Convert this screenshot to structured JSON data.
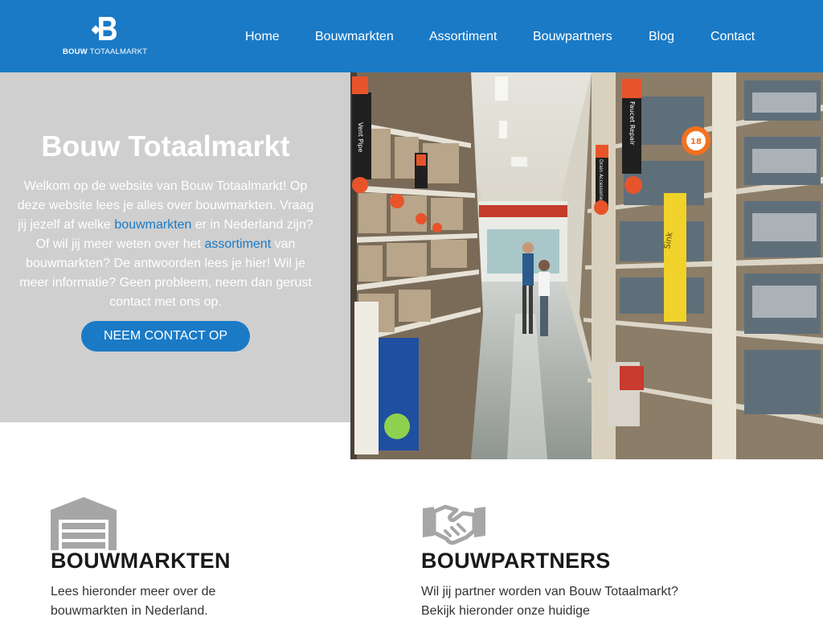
{
  "header": {
    "logo_text_bold": "BOUW",
    "logo_text_rest": "TOTAALMARKT",
    "nav": [
      {
        "label": "Home"
      },
      {
        "label": "Bouwmarkten"
      },
      {
        "label": "Assortiment"
      },
      {
        "label": "Bouwpartners"
      },
      {
        "label": "Blog"
      },
      {
        "label": "Contact"
      }
    ]
  },
  "hero": {
    "title": "Bouw Totaalmarkt",
    "text_1": "Welkom op de website van Bouw Totaalmarkt! Op deze website lees je alles over bouwmarkten. Vraag jij jezelf af welke ",
    "link_1": "bouwmarkten",
    "text_2": " er in Nederland zijn? Of wil jij meer weten over het ",
    "link_2": "assortiment",
    "text_3": " van bouwmarkten? De antwoorden lees je hier! Wil je meer informatie? Geen probleem, neem dan gerust contact met ons op.",
    "cta_label": "NEEM CONTACT OP"
  },
  "photo": {
    "signs": [
      "Vent Pipe",
      "Faucet Repair",
      "Drain Accessories",
      "Sink"
    ],
    "aisle_number": "18"
  },
  "features": [
    {
      "icon": "warehouse-icon",
      "title": "BOUWMARKTEN",
      "text": "Lees hieronder meer over de bouwmarkten in Nederland."
    },
    {
      "icon": "handshake-icon",
      "title": "BOUWPARTNERS",
      "text": "Wil jij partner worden van Bouw Totaalmarkt? Bekijk hieronder onze huidige"
    }
  ],
  "colors": {
    "brand_blue": "#1a7ac6",
    "hero_gray": "#cfcfcf",
    "icon_gray": "#a6a6a6"
  }
}
